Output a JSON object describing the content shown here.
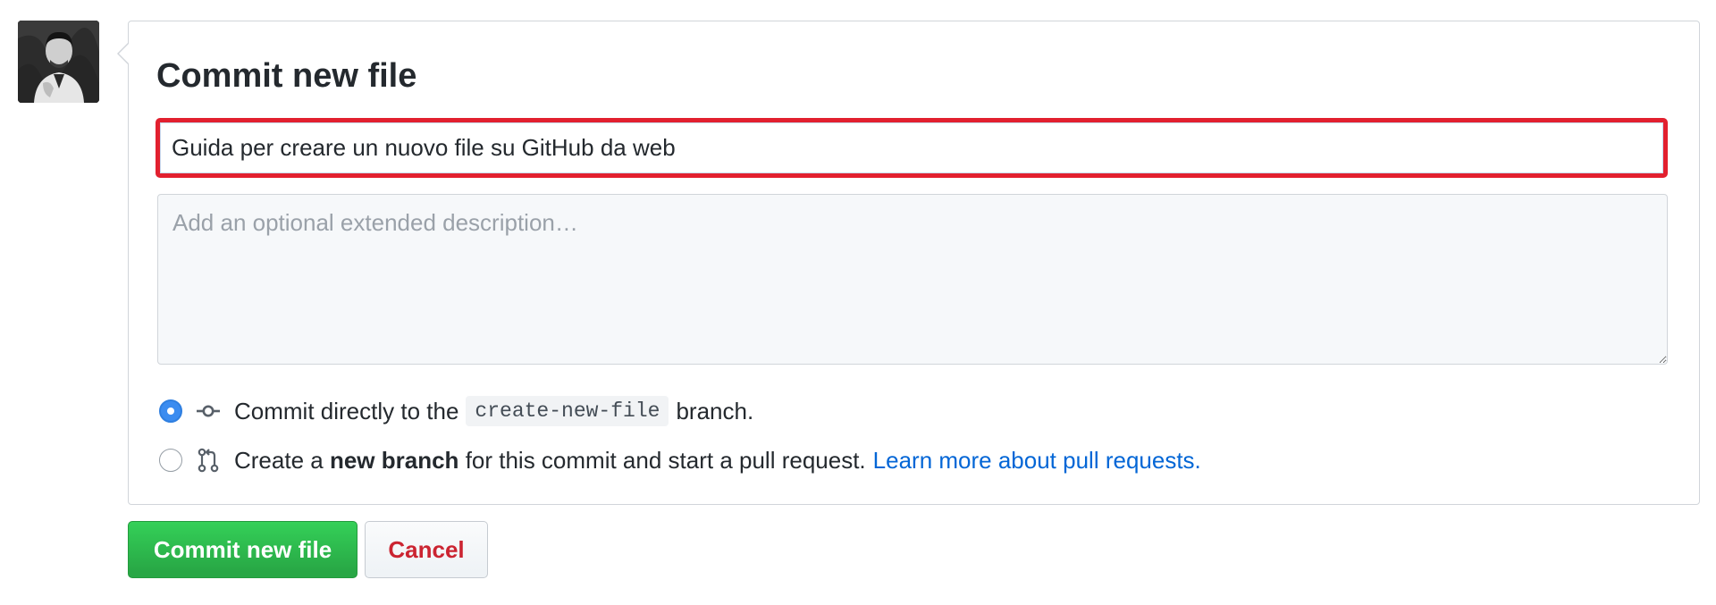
{
  "user": {
    "avatar_icon": "user-avatar-photo"
  },
  "commit_form": {
    "title": "Commit new file",
    "summary_value": "Guida per creare un nuovo file su GitHub da web",
    "description_placeholder": "Add an optional extended description…",
    "description_value": "",
    "options": [
      {
        "selected": true,
        "icon": "git-commit-icon",
        "text_before": "Commit directly to the",
        "branch": "create-new-file",
        "text_after": "branch."
      },
      {
        "selected": false,
        "icon": "git-pull-request-icon",
        "text_before": "Create a",
        "bold_text": "new branch",
        "text_after": "for this commit and start a pull request.",
        "link_text": "Learn more about pull requests."
      }
    ],
    "commit_button_label": "Commit new file",
    "cancel_button_label": "Cancel"
  },
  "colors": {
    "highlight_border": "#e2202f",
    "primary_button": "#28a745",
    "cancel_text": "#cb2431",
    "link": "#0366d6",
    "radio_checked": "#3b8cf0"
  }
}
